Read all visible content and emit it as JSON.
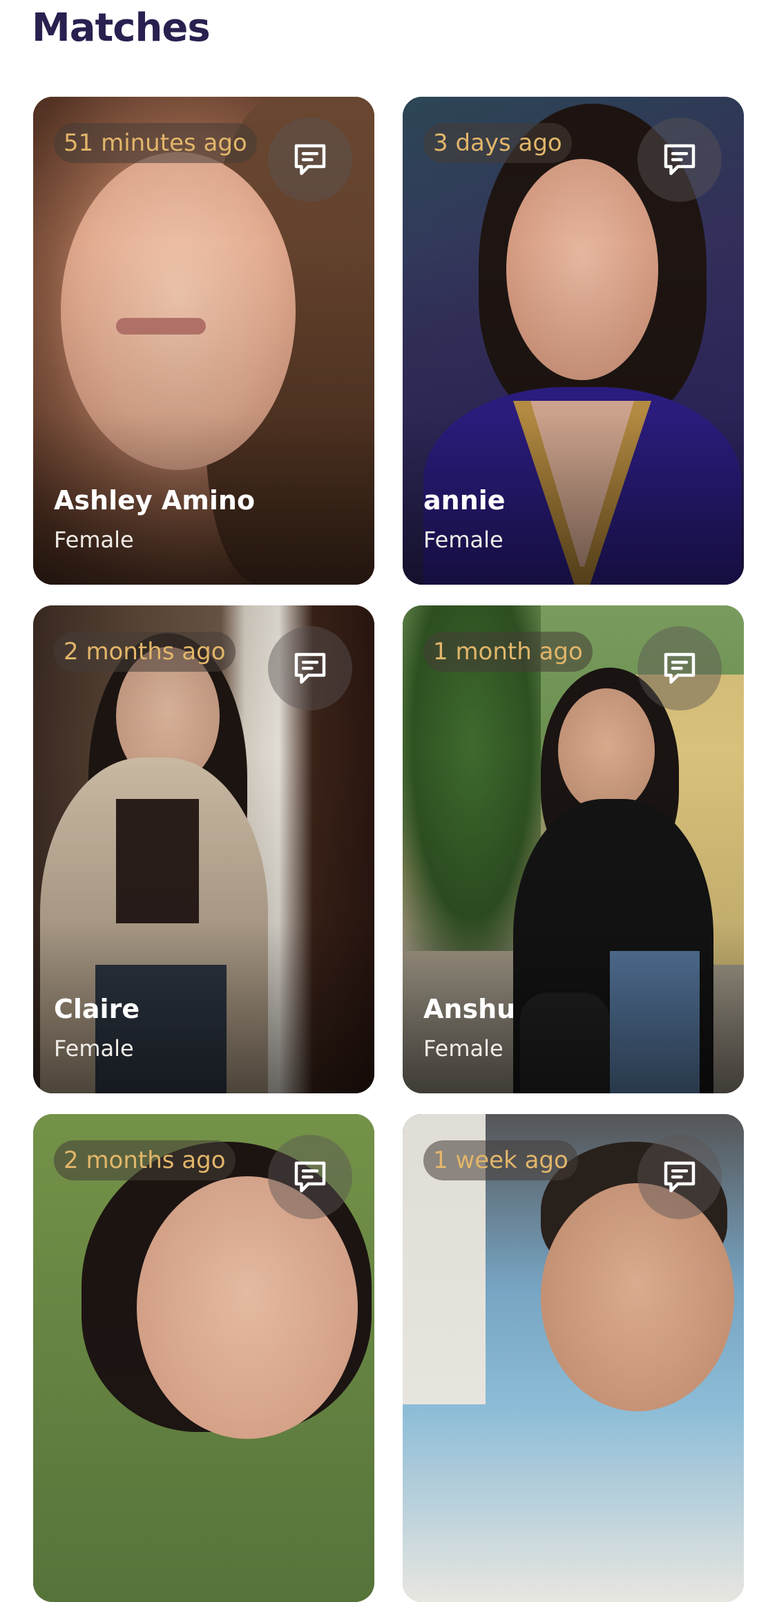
{
  "header": {
    "title": "Matches"
  },
  "matches": [
    {
      "time": "51 minutes ago",
      "name": "Ashley Amino",
      "gender": "Female"
    },
    {
      "time": "3 days ago",
      "name": "annie",
      "gender": "Female"
    },
    {
      "time": "2 months ago",
      "name": "Claire",
      "gender": "Female"
    },
    {
      "time": "1 month ago",
      "name": "Anshu",
      "gender": "Female"
    },
    {
      "time": "2 months ago",
      "name": "",
      "gender": ""
    },
    {
      "time": "1 week ago",
      "name": "",
      "gender": ""
    }
  ],
  "icons": {
    "message": "message-icon"
  },
  "colors": {
    "title": "#2a2050",
    "badge_text": "#e2b66a"
  }
}
